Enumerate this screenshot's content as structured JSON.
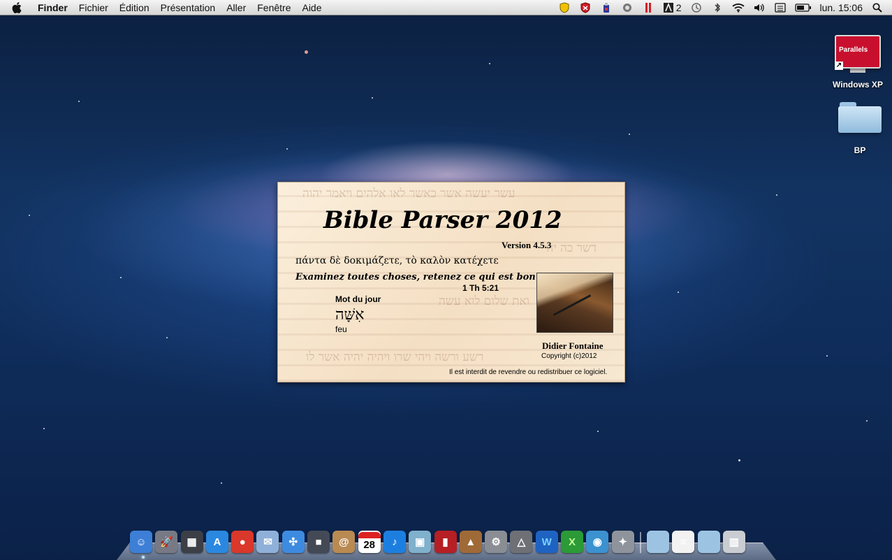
{
  "menubar": {
    "apple_icon": "apple-icon",
    "items": [
      {
        "label": "Finder",
        "bold": true
      },
      {
        "label": "Fichier"
      },
      {
        "label": "Édition"
      },
      {
        "label": "Présentation"
      },
      {
        "label": "Aller"
      },
      {
        "label": "Fenêtre"
      },
      {
        "label": "Aide"
      }
    ],
    "status": {
      "adobe_count": "2",
      "clock": "lun. 15:06"
    }
  },
  "desktop_icons": [
    {
      "label": "Windows XP",
      "icon": "parallels-vm-icon",
      "logo_text": "Parallels"
    },
    {
      "label": "BP",
      "icon": "folder-icon"
    }
  ],
  "splash": {
    "title": "Bible Parser 2012",
    "version": "Version 4.5.3",
    "greek_verse": "πάντα δὲ δοκιμάζετε, τὸ καλὸν κατέχετε",
    "french_verse": "Examinez toutes choses, retenez ce qui est bon",
    "reference": "1 Th 5:21",
    "word_of_day_label": "Mot du jour",
    "hebrew_word": "אִשָּׁה",
    "gloss": "feu",
    "author": "Didier Fontaine",
    "copyright": "Copyright (c)2012",
    "warning": "Il est interdit de revendre ou redistribuer ce logiciel."
  },
  "dock": {
    "calendar_day": "28",
    "items": [
      {
        "name": "finder-icon",
        "color": "#3d7fd6"
      },
      {
        "name": "launchpad-icon",
        "color": "#777a85"
      },
      {
        "name": "mission-control-icon",
        "color": "#3c3f46"
      },
      {
        "name": "app-store-icon",
        "color": "#2a88e0"
      },
      {
        "name": "chrome-icon",
        "color": "#d9382b"
      },
      {
        "name": "mail-icon",
        "color": "#8fb0d8"
      },
      {
        "name": "safari-icon",
        "color": "#3d8be0"
      },
      {
        "name": "facetime-icon",
        "color": "#444a55"
      },
      {
        "name": "address-book-icon",
        "color": "#b98a52"
      },
      {
        "name": "calendar-icon",
        "color": "#ffffff"
      },
      {
        "name": "itunes-icon",
        "color": "#1c7fe0"
      },
      {
        "name": "preview-icon",
        "color": "#7fb0cc"
      },
      {
        "name": "photo-booth-icon",
        "color": "#b61f24"
      },
      {
        "name": "iphoto-icon",
        "color": "#a06a38"
      },
      {
        "name": "system-preferences-icon",
        "color": "#8a8d93"
      },
      {
        "name": "terminal-icon",
        "color": "#6e7076"
      },
      {
        "name": "word-icon",
        "color": "#1f63c2"
      },
      {
        "name": "excel-icon",
        "color": "#2b9a37"
      },
      {
        "name": "network-icon",
        "color": "#3c91d0"
      },
      {
        "name": "directory-utility-icon",
        "color": "#8f949c"
      }
    ],
    "stacks": [
      {
        "name": "applications-folder-icon",
        "color": "#9cc4e2"
      },
      {
        "name": "documents-stack-icon",
        "color": "#f2f2f2"
      },
      {
        "name": "downloads-folder-icon",
        "color": "#9cc4e2"
      },
      {
        "name": "trash-icon",
        "color": "#c9ccd1"
      }
    ]
  }
}
